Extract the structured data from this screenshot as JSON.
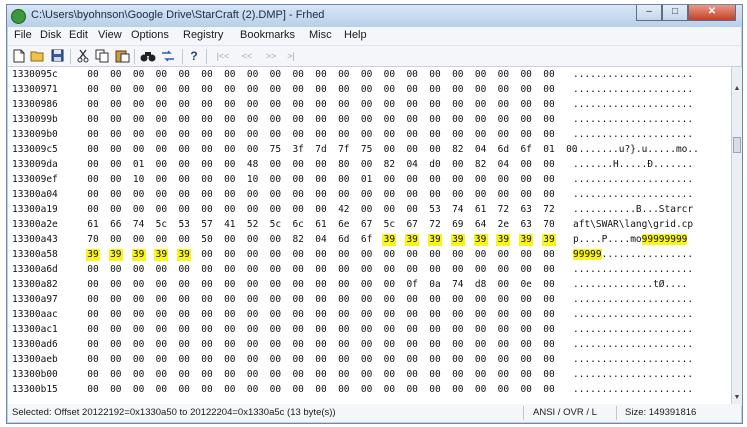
{
  "window": {
    "title": "C:\\Users\\byohnson\\Google Drive\\StarCraft (2).DMP] - Frhed",
    "min_label": "–",
    "max_label": "□",
    "close_label": "✕"
  },
  "menu": [
    "File",
    "Disk",
    "Edit",
    "View",
    "Options",
    "Registry",
    "Bookmarks",
    "Misc",
    "Help"
  ],
  "toolbar": {
    "new_icon": "new-file-icon",
    "open_icon": "open-folder-icon",
    "save_icon": "save-icon",
    "cut_icon": "cut-icon",
    "copy_icon": "copy-icon",
    "paste_icon": "paste-icon",
    "find_icon": "binoculars-icon",
    "replace_icon": "replace-icon",
    "help_icon": "help-icon",
    "nav_first": "|<<",
    "nav_prev": "<<",
    "nav_next": ">>",
    "nav_last": ">|"
  },
  "hex": {
    "rows": [
      {
        "offset": "1330095c",
        "bytes": [
          "00",
          "00",
          "00",
          "00",
          "00",
          "00",
          "00",
          "00",
          "00",
          "00",
          "00",
          "00",
          "00",
          "00",
          "00",
          "00",
          "00",
          "00",
          "00",
          "00",
          "00"
        ],
        "ascii": "....................."
      },
      {
        "offset": "13300971",
        "bytes": [
          "00",
          "00",
          "00",
          "00",
          "00",
          "00",
          "00",
          "00",
          "00",
          "00",
          "00",
          "00",
          "00",
          "00",
          "00",
          "00",
          "00",
          "00",
          "00",
          "00",
          "00"
        ],
        "ascii": "....................."
      },
      {
        "offset": "13300986",
        "bytes": [
          "00",
          "00",
          "00",
          "00",
          "00",
          "00",
          "00",
          "00",
          "00",
          "00",
          "00",
          "00",
          "00",
          "00",
          "00",
          "00",
          "00",
          "00",
          "00",
          "00",
          "00"
        ],
        "ascii": "....................."
      },
      {
        "offset": "1330099b",
        "bytes": [
          "00",
          "00",
          "00",
          "00",
          "00",
          "00",
          "00",
          "00",
          "00",
          "00",
          "00",
          "00",
          "00",
          "00",
          "00",
          "00",
          "00",
          "00",
          "00",
          "00",
          "00"
        ],
        "ascii": "....................."
      },
      {
        "offset": "133009b0",
        "bytes": [
          "00",
          "00",
          "00",
          "00",
          "00",
          "00",
          "00",
          "00",
          "00",
          "00",
          "00",
          "00",
          "00",
          "00",
          "00",
          "00",
          "00",
          "00",
          "00",
          "00",
          "00"
        ],
        "ascii": "....................."
      },
      {
        "offset": "133009c5",
        "bytes": [
          "00",
          "00",
          "00",
          "00",
          "00",
          "00",
          "00",
          "00",
          "75",
          "3f",
          "7d",
          "7f",
          "75",
          "00",
          "00",
          "00",
          "82",
          "04",
          "6d",
          "6f",
          "01",
          "00"
        ],
        "ascii": "........u?}.u.....mo.."
      },
      {
        "offset": "133009da",
        "bytes": [
          "00",
          "00",
          "01",
          "00",
          "00",
          "00",
          "00",
          "48",
          "00",
          "00",
          "00",
          "80",
          "00",
          "82",
          "04",
          "d0",
          "00",
          "82",
          "04",
          "00",
          "00"
        ],
        "ascii": ".......H.....Ð......."
      },
      {
        "offset": "133009ef",
        "bytes": [
          "00",
          "00",
          "10",
          "00",
          "00",
          "00",
          "00",
          "10",
          "00",
          "00",
          "00",
          "00",
          "01",
          "00",
          "00",
          "00",
          "00",
          "00",
          "00",
          "00",
          "00"
        ],
        "ascii": "....................."
      },
      {
        "offset": "13300a04",
        "bytes": [
          "00",
          "00",
          "00",
          "00",
          "00",
          "00",
          "00",
          "00",
          "00",
          "00",
          "00",
          "00",
          "00",
          "00",
          "00",
          "00",
          "00",
          "00",
          "00",
          "00",
          "00"
        ],
        "ascii": "....................."
      },
      {
        "offset": "13300a19",
        "bytes": [
          "00",
          "00",
          "00",
          "00",
          "00",
          "00",
          "00",
          "00",
          "00",
          "00",
          "00",
          "42",
          "00",
          "00",
          "00",
          "53",
          "74",
          "61",
          "72",
          "63",
          "72"
        ],
        "ascii": "...........B...Starcr"
      },
      {
        "offset": "13300a2e",
        "bytes": [
          "61",
          "66",
          "74",
          "5c",
          "53",
          "57",
          "41",
          "52",
          "5c",
          "6c",
          "61",
          "6e",
          "67",
          "5c",
          "67",
          "72",
          "69",
          "64",
          "2e",
          "63",
          "70"
        ],
        "ascii": "aft\\SWAR\\lang\\grid.cp"
      },
      {
        "offset": "13300a43",
        "bytes": [
          "70",
          "00",
          "00",
          "00",
          "00",
          "50",
          "00",
          "00",
          "00",
          "82",
          "04",
          "6d",
          "6f",
          "39",
          "39",
          "39",
          "39",
          "39",
          "39",
          "39",
          "39"
        ],
        "ascii": "p....P....mo99999999",
        "highlight_from": 13
      },
      {
        "offset": "13300a58",
        "bytes": [
          "39",
          "39",
          "39",
          "39",
          "39",
          "00",
          "00",
          "00",
          "00",
          "00",
          "00",
          "00",
          "00",
          "00",
          "00",
          "00",
          "00",
          "00",
          "00",
          "00",
          "00"
        ],
        "ascii": "99999................",
        "highlight_to": 5
      },
      {
        "offset": "13300a6d",
        "bytes": [
          "00",
          "00",
          "00",
          "00",
          "00",
          "00",
          "00",
          "00",
          "00",
          "00",
          "00",
          "00",
          "00",
          "00",
          "00",
          "00",
          "00",
          "00",
          "00",
          "00",
          "00"
        ],
        "ascii": "....................."
      },
      {
        "offset": "13300a82",
        "bytes": [
          "00",
          "00",
          "00",
          "00",
          "00",
          "00",
          "00",
          "00",
          "00",
          "00",
          "00",
          "00",
          "00",
          "00",
          "0f",
          "0a",
          "74",
          "d8",
          "00",
          "0e",
          "00"
        ],
        "ascii": "..............tØ...."
      },
      {
        "offset": "13300a97",
        "bytes": [
          "00",
          "00",
          "00",
          "00",
          "00",
          "00",
          "00",
          "00",
          "00",
          "00",
          "00",
          "00",
          "00",
          "00",
          "00",
          "00",
          "00",
          "00",
          "00",
          "00",
          "00"
        ],
        "ascii": "....................."
      },
      {
        "offset": "13300aac",
        "bytes": [
          "00",
          "00",
          "00",
          "00",
          "00",
          "00",
          "00",
          "00",
          "00",
          "00",
          "00",
          "00",
          "00",
          "00",
          "00",
          "00",
          "00",
          "00",
          "00",
          "00",
          "00"
        ],
        "ascii": "....................."
      },
      {
        "offset": "13300ac1",
        "bytes": [
          "00",
          "00",
          "00",
          "00",
          "00",
          "00",
          "00",
          "00",
          "00",
          "00",
          "00",
          "00",
          "00",
          "00",
          "00",
          "00",
          "00",
          "00",
          "00",
          "00",
          "00"
        ],
        "ascii": "....................."
      },
      {
        "offset": "13300ad6",
        "bytes": [
          "00",
          "00",
          "00",
          "00",
          "00",
          "00",
          "00",
          "00",
          "00",
          "00",
          "00",
          "00",
          "00",
          "00",
          "00",
          "00",
          "00",
          "00",
          "00",
          "00",
          "00"
        ],
        "ascii": "....................."
      },
      {
        "offset": "13300aeb",
        "bytes": [
          "00",
          "00",
          "00",
          "00",
          "00",
          "00",
          "00",
          "00",
          "00",
          "00",
          "00",
          "00",
          "00",
          "00",
          "00",
          "00",
          "00",
          "00",
          "00",
          "00",
          "00"
        ],
        "ascii": "....................."
      },
      {
        "offset": "13300b00",
        "bytes": [
          "00",
          "00",
          "00",
          "00",
          "00",
          "00",
          "00",
          "00",
          "00",
          "00",
          "00",
          "00",
          "00",
          "00",
          "00",
          "00",
          "00",
          "00",
          "00",
          "00",
          "00"
        ],
        "ascii": "....................."
      },
      {
        "offset": "13300b15",
        "bytes": [
          "00",
          "00",
          "00",
          "00",
          "00",
          "00",
          "00",
          "00",
          "00",
          "00",
          "00",
          "00",
          "00",
          "00",
          "00",
          "00",
          "00",
          "00",
          "00",
          "00",
          "00"
        ],
        "ascii": "....................."
      }
    ]
  },
  "colors": {
    "selection": "#f8f51b",
    "titlebar": "#c8dbf0",
    "close_button": "#c4402a"
  },
  "status": {
    "selection": "Selected: Offset 20122192=0x1330a50 to 20122204=0x1330a5c (13 byte(s))",
    "mode": "ANSI / OVR / L",
    "size": "Size: 149391816"
  }
}
